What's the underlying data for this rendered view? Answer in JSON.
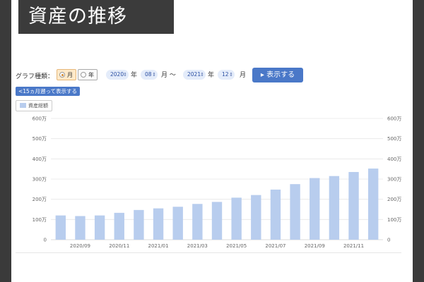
{
  "page": {
    "title": "資産の推移"
  },
  "controls": {
    "graph_type_label": "グラフ種類：",
    "monthly_label": "月",
    "yearly_label": "年",
    "from_year": "2020",
    "from_year_unit": "年",
    "from_month": "08",
    "from_month_unit": "月 〜",
    "to_year": "2021",
    "to_year_unit": "年",
    "to_month": "12",
    "to_month_unit": "月",
    "show_button": "▸ 表示する",
    "back15_button": "<15ヵ月遡って表示する"
  },
  "legend": {
    "label": "資産総額"
  },
  "colors": {
    "bar": "#b8cdee",
    "button": "#4a78c8",
    "grid": "#e6e6e6"
  },
  "chart_data": {
    "type": "bar",
    "categories": [
      "2020/08",
      "2020/09",
      "2020/10",
      "2020/11",
      "2020/12",
      "2021/01",
      "2021/02",
      "2021/03",
      "2021/04",
      "2021/05",
      "2021/06",
      "2021/07",
      "2021/08",
      "2021/09",
      "2021/10",
      "2021/11",
      "2021/12"
    ],
    "x_tick_labels": [
      "2020/09",
      "2020/11",
      "2021/01",
      "2021/03",
      "2021/05",
      "2021/07",
      "2021/09",
      "2021/11"
    ],
    "series": [
      {
        "name": "資産総額",
        "values": [
          120,
          117,
          120,
          133,
          147,
          155,
          163,
          177,
          187,
          208,
          221,
          248,
          275,
          305,
          315,
          335,
          352
        ]
      }
    ],
    "y_ticks": [
      "0",
      "100万",
      "200万",
      "300万",
      "400万",
      "500万",
      "600万"
    ],
    "ylim": [
      0,
      600
    ],
    "grid": true,
    "legend_position": "top-left"
  }
}
